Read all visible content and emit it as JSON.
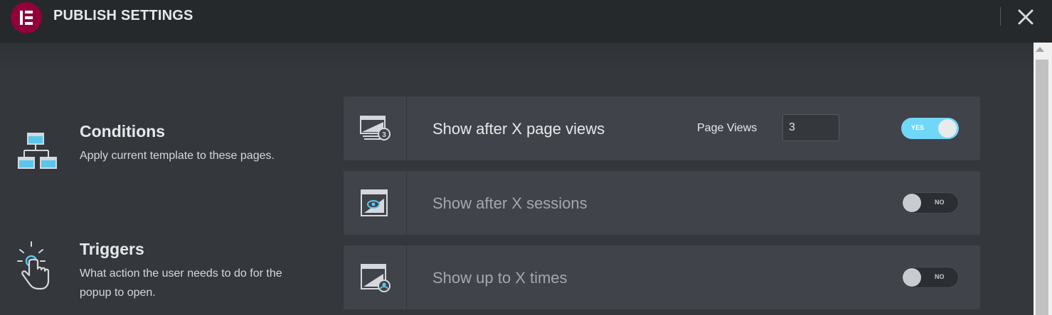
{
  "header": {
    "title": "PUBLISH SETTINGS",
    "logo_icon": "elementor-logo",
    "close_icon": "close-icon",
    "brand_color": "#92003b"
  },
  "sidebar": {
    "items": [
      {
        "title": "Conditions",
        "description": "Apply current template to these pages.",
        "icon": "sitemap-icon"
      },
      {
        "title": "Triggers",
        "description": "What action the user needs to do for the popup to open.",
        "icon": "tap-hand-icon"
      }
    ]
  },
  "rules": [
    {
      "label": "Show after X page views",
      "icon": "page-views-icon",
      "enabled": true,
      "toggle_text": "YES",
      "field_label": "Page Views",
      "field_value": "3"
    },
    {
      "label": "Show after X sessions",
      "icon": "sessions-icon",
      "enabled": false,
      "toggle_text": "NO"
    },
    {
      "label": "Show up to X times",
      "icon": "user-times-icon",
      "enabled": false,
      "toggle_text": "NO"
    }
  ],
  "colors": {
    "toggle_on": "#71d7f7",
    "accent_blue": "#5bc6ec"
  }
}
